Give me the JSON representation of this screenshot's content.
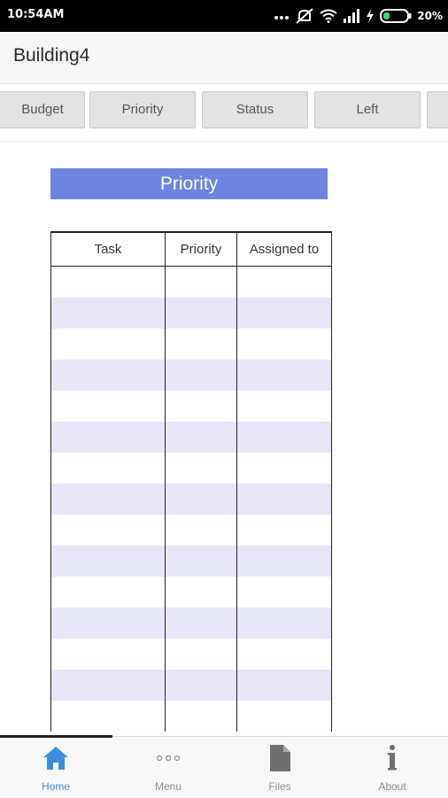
{
  "status_bar": {
    "time": "10:54AM",
    "battery": "20%",
    "icons": [
      "dots-icon",
      "mute-icon",
      "wifi-icon",
      "signal-icon",
      "charging-icon",
      "battery-icon"
    ]
  },
  "app": {
    "title": "Building4"
  },
  "tabs": [
    {
      "label": "Budget"
    },
    {
      "label": "Priority"
    },
    {
      "label": "Status"
    },
    {
      "label": "Left"
    }
  ],
  "section": {
    "title": "Priority"
  },
  "table": {
    "columns": [
      "Task",
      "Priority",
      "Assigned to"
    ],
    "rows": [
      [
        "",
        "",
        ""
      ],
      [
        "",
        "",
        ""
      ],
      [
        "",
        "",
        ""
      ],
      [
        "",
        "",
        ""
      ],
      [
        "",
        "",
        ""
      ],
      [
        "",
        "",
        ""
      ],
      [
        "",
        "",
        ""
      ],
      [
        "",
        "",
        ""
      ],
      [
        "",
        "",
        ""
      ],
      [
        "",
        "",
        ""
      ],
      [
        "",
        "",
        ""
      ],
      [
        "",
        "",
        ""
      ],
      [
        "",
        "",
        ""
      ],
      [
        "",
        "",
        ""
      ],
      [
        "",
        "",
        ""
      ]
    ]
  },
  "bottom_nav": {
    "items": [
      {
        "label": "Home",
        "icon": "home-icon",
        "active": true
      },
      {
        "label": "Menu",
        "icon": "more-dots-icon",
        "active": false
      },
      {
        "label": "Files",
        "icon": "file-icon",
        "active": false
      },
      {
        "label": "About",
        "icon": "info-icon",
        "active": false
      }
    ]
  },
  "colors": {
    "section_header_bg": "#6d84e0",
    "row_alt_bg": "#e6e6f8",
    "nav_active": "#3c8ee0",
    "nav_inactive": "#8c8c8c"
  }
}
